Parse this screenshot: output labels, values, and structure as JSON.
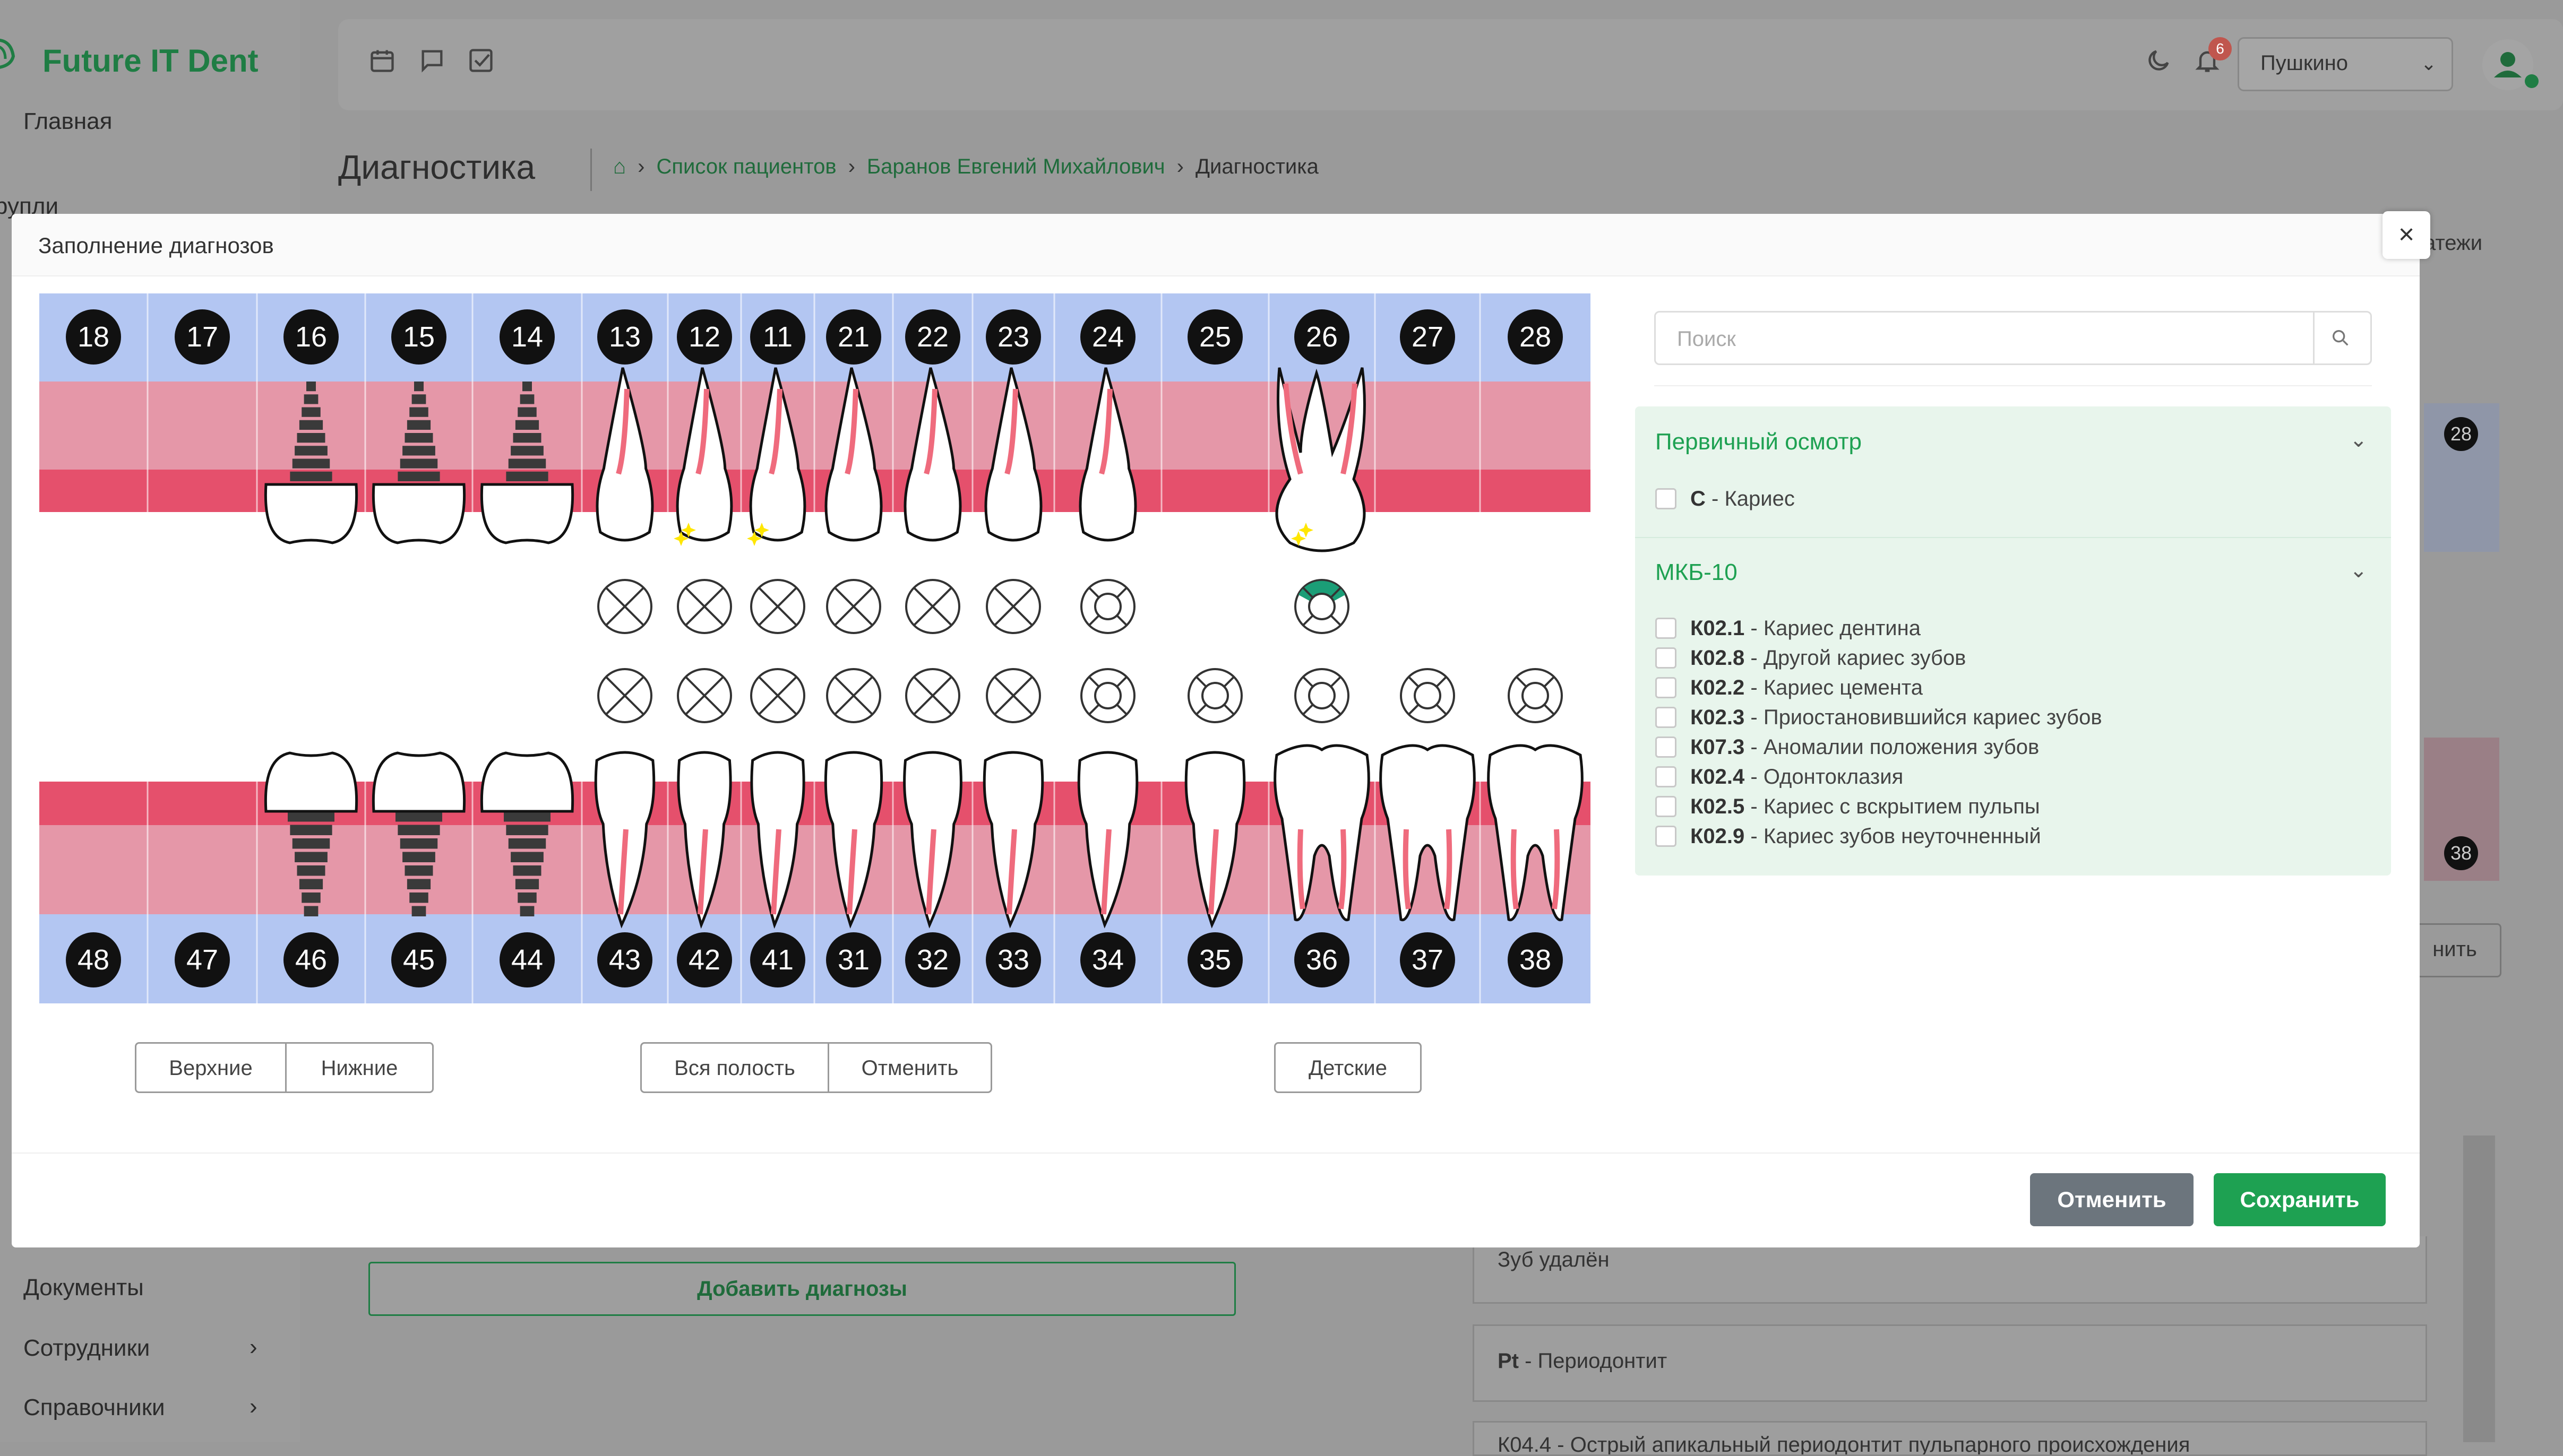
{
  "app": {
    "title": "Future IT Dent"
  },
  "sidebar": {
    "top_items": [
      {
        "label": "Главная"
      },
      {
        "label": "рупли"
      }
    ],
    "bottom_items": [
      {
        "label": "Документы"
      },
      {
        "label": "Сотрудники"
      },
      {
        "label": "Справочники"
      }
    ]
  },
  "header": {
    "city": "Пушкино",
    "notifications_count": "6"
  },
  "page": {
    "title": "Диагностика",
    "breadcrumbs": [
      "Список пациентов",
      "Баранов Евгений Михайлович",
      "Диагностика"
    ]
  },
  "background": {
    "add_diagnoses_label": "Добавить диагнозы",
    "tooth_removed_label": "Зуб удалён",
    "pt_code": "Pt",
    "pt_label": " - Периодонтит",
    "side_tab_label": "атежи",
    "side_button_label": "нить",
    "side_tooth_top": "28",
    "side_tooth_bottom": "38",
    "truncated_row": "К04.4 - Острый апикальный периодонтит пульпарного происхождения"
  },
  "modal": {
    "title": "Заполнение диагнозов",
    "close_label": "×",
    "upper_teeth": [
      "18",
      "17",
      "16",
      "15",
      "14",
      "13",
      "12",
      "11",
      "21",
      "22",
      "23",
      "24",
      "25",
      "26",
      "27",
      "28"
    ],
    "lower_teeth": [
      "48",
      "47",
      "46",
      "45",
      "44",
      "43",
      "42",
      "41",
      "31",
      "32",
      "33",
      "34",
      "35",
      "36",
      "37",
      "38"
    ],
    "jaw_buttons": {
      "upper": "Верхние",
      "lower": "Нижние"
    },
    "mouth_buttons": {
      "all": "Вся полость",
      "cancel": "Отменить"
    },
    "children_button": "Детские",
    "search_placeholder": "Поиск",
    "sections": [
      {
        "title": "Первичный осмотр",
        "items": [
          {
            "code": "С",
            "label": " - Кариес"
          }
        ]
      },
      {
        "title": "МКБ-10",
        "items": [
          {
            "code": "К02.1",
            "label": " - Кариес дентина"
          },
          {
            "code": "К02.8",
            "label": " - Другой кариес зубов"
          },
          {
            "code": "К02.2",
            "label": " - Кариес цемента"
          },
          {
            "code": "К02.3",
            "label": " - Приостановившийся кариес зубов"
          },
          {
            "code": "К07.3",
            "label": " - Аномалии положения зубов"
          },
          {
            "code": "К02.4",
            "label": " - Одонтоклазия"
          },
          {
            "code": "К02.5",
            "label": " - Кариес с вскрытием пульпы"
          },
          {
            "code": "К02.9",
            "label": " - Кариес зубов неуточненный"
          }
        ]
      }
    ],
    "footer": {
      "cancel": "Отменить",
      "save": "Сохранить"
    }
  },
  "dental_chart": {
    "upper_implants": [
      "16",
      "15",
      "14"
    ],
    "lower_implants": [
      "46",
      "45",
      "44"
    ],
    "upper_missing": [
      "18",
      "17",
      "25",
      "27",
      "28"
    ],
    "lower_missing": [
      "48",
      "47"
    ],
    "upper_caries_marks": [
      "12",
      "11",
      "26"
    ],
    "upper_row_crossed": [
      "13",
      "12",
      "11",
      "21",
      "22",
      "23"
    ],
    "upper_row_rings": [
      "24",
      "26"
    ],
    "lower_row_crossed": [
      "13",
      "12",
      "11",
      "21",
      "22",
      "23"
    ],
    "lower_row_rings": [
      "24",
      "25",
      "26",
      "27",
      "28"
    ],
    "highlighted_surface_tooth": "26",
    "colors": {
      "header_row": "#b3c6f2",
      "gum_light": "#e597a8",
      "gum_dark": "#e5506c",
      "number_badge": "#111111",
      "caries": "#ffe600",
      "surface_highlight": "#1b9e77",
      "root_canal": "#ef6b7d"
    }
  }
}
